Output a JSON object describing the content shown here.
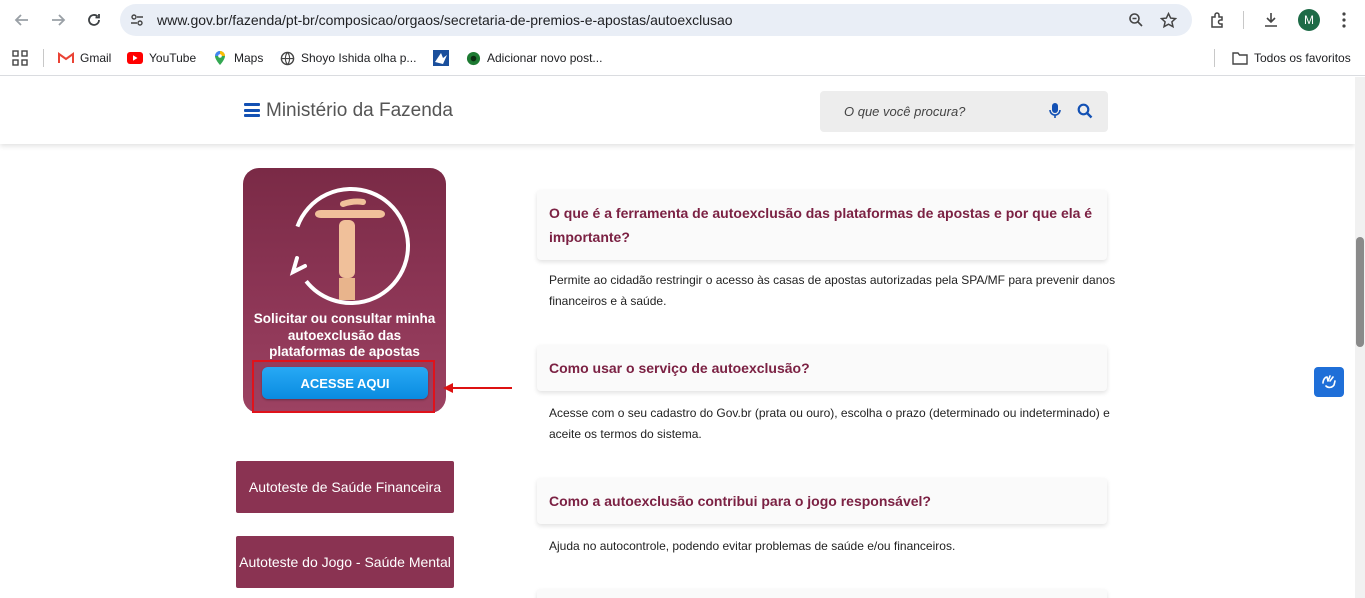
{
  "browser": {
    "url": "www.gov.br/fazenda/pt-br/composicao/orgaos/secretaria-de-premios-e-apostas/autoexclusao",
    "avatar_letter": "M",
    "bookmarks": [
      {
        "label": "Gmail",
        "icon": "gmail-icon"
      },
      {
        "label": "YouTube",
        "icon": "youtube-icon"
      },
      {
        "label": "Maps",
        "icon": "maps-icon"
      },
      {
        "label": "Shoyo Ishida olha p...",
        "icon": "globe-icon"
      },
      {
        "label": "",
        "icon": "site-logo-icon"
      },
      {
        "label": "Adicionar novo post...",
        "icon": "green-circle-icon"
      }
    ],
    "all_favorites": "Todos os favoritos"
  },
  "header": {
    "title": "Ministério da Fazenda",
    "search_placeholder": "O que você procura?"
  },
  "promo": {
    "text": "Solicitar ou consultar minha autoexclusão das plataformas de apostas",
    "button": "ACESSE AQUI"
  },
  "side_buttons": [
    "Autoteste de Saúde Financeira",
    "Autoteste do Jogo - Saúde Mental"
  ],
  "faq": [
    {
      "question": "O que é a ferramenta de autoexclusão das plataformas de apostas e por que ela é importante?",
      "answer": "Permite ao cidadão restringir o acesso às casas de apostas autorizadas pela SPA/MF para prevenir danos financeiros e à saúde."
    },
    {
      "question": "Como usar o serviço de autoexclusão?",
      "answer": "Acesse com o seu cadastro do Gov.br (prata ou ouro), escolha o prazo (determinado ou indeterminado) e aceite os termos do sistema."
    },
    {
      "question": "Como a autoexclusão contribui para o jogo responsável?",
      "answer": "Ajuda no autocontrole, podendo evitar problemas de saúde e/ou financeiros."
    }
  ],
  "colors": {
    "brand_wine": "#8a3352",
    "question_text": "#7b2143",
    "cta_blue": "#0a8be0",
    "highlight_red": "#e0121b",
    "gov_blue": "#1351b4"
  }
}
